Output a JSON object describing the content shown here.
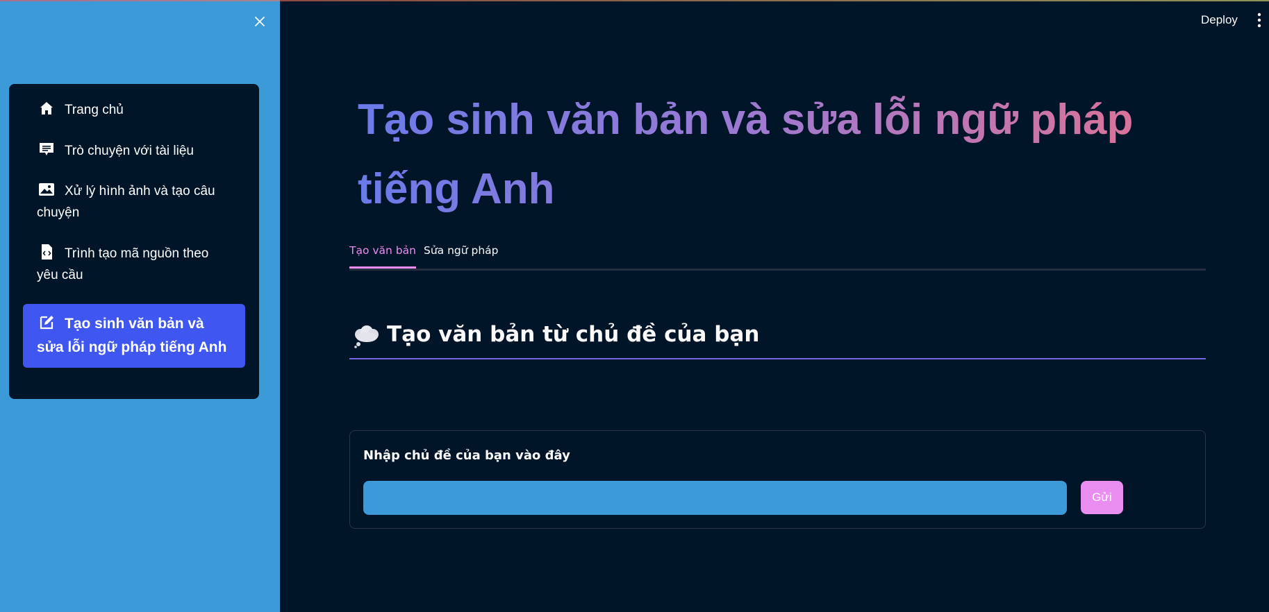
{
  "app": {
    "deploy_label": "Deploy",
    "menu_icon": "kebab-icon"
  },
  "sidebar": {
    "close_icon": "close-icon",
    "items": [
      {
        "label": "Trang chủ",
        "icon": "home-icon"
      },
      {
        "label": "Trò chuyện với tài liệu",
        "icon": "chat-icon"
      },
      {
        "label": "Xử lý hình ảnh và tạo câu chuyện",
        "icon": "image-icon"
      },
      {
        "label": "Trình tạo mã nguồn theo yêu cầu",
        "icon": "code-file-icon"
      },
      {
        "label": "Tạo sinh văn bản và sửa lỗi ngữ pháp tiếng Anh",
        "icon": "edit-icon",
        "active": true
      }
    ]
  },
  "main": {
    "title": "Tạo sinh văn bản và sửa lỗi ngữ pháp tiếng Anh",
    "tabs": [
      {
        "label": "Tạo văn bản",
        "active": true
      },
      {
        "label": "Sửa ngữ pháp"
      }
    ],
    "section": {
      "emoji": "thought-bubble-icon",
      "heading": "Tạo văn bản từ chủ đề của bạn"
    },
    "form": {
      "label": "Nhập chủ đề của bạn vào đây",
      "input_value": "",
      "submit_label": "Gửi"
    }
  },
  "colors": {
    "sidebar_bg": "#3d9ad8",
    "main_bg": "#011528",
    "nav_active": "#3f57f0",
    "accent_pink": "#ed8cf1",
    "section_underline": "#7466e6"
  }
}
